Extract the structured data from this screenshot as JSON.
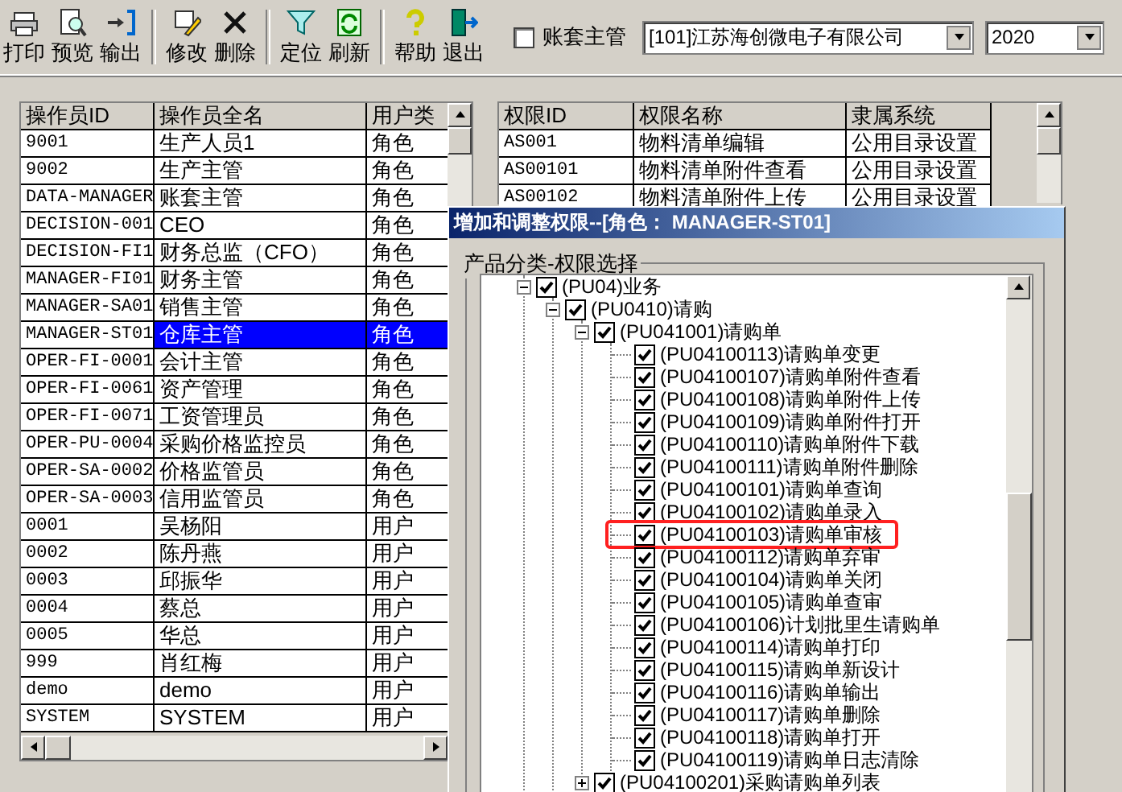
{
  "toolbar": {
    "groups": [
      [
        {
          "label": "打印"
        },
        {
          "label": "预览"
        },
        {
          "label": "输出"
        }
      ],
      [
        {
          "label": "修改"
        },
        {
          "label": "删除"
        }
      ],
      [
        {
          "label": "定位"
        },
        {
          "label": "刷新"
        }
      ],
      [
        {
          "label": "帮助"
        },
        {
          "label": "退出"
        }
      ]
    ],
    "checkbox": {
      "label": "账套主管",
      "checked": false
    },
    "company": {
      "value": "[101]江苏海创微电子有限公司"
    },
    "year": {
      "value": "2020"
    }
  },
  "operators": {
    "columns": [
      "操作员ID",
      "操作员全名",
      "用户类"
    ],
    "rows": [
      {
        "cells": [
          "9001",
          "生产人员1",
          "角色"
        ],
        "selected": false
      },
      {
        "cells": [
          "9002",
          "生产主管",
          "角色"
        ],
        "selected": false
      },
      {
        "cells": [
          "DATA-MANAGER",
          "账套主管",
          "角色"
        ],
        "selected": false
      },
      {
        "cells": [
          "DECISION-001",
          "CEO",
          "角色"
        ],
        "selected": false
      },
      {
        "cells": [
          "DECISION-FI1",
          "财务总监（CFO）",
          "角色"
        ],
        "selected": false
      },
      {
        "cells": [
          "MANAGER-FI01",
          "财务主管",
          "角色"
        ],
        "selected": false
      },
      {
        "cells": [
          "MANAGER-SA01",
          "销售主管",
          "角色"
        ],
        "selected": false
      },
      {
        "cells": [
          "MANAGER-ST01",
          "仓库主管",
          "角色"
        ],
        "selected": true
      },
      {
        "cells": [
          "OPER-FI-0001",
          "会计主管",
          "角色"
        ],
        "selected": false
      },
      {
        "cells": [
          "OPER-FI-0061",
          "资产管理",
          "角色"
        ],
        "selected": false
      },
      {
        "cells": [
          "OPER-FI-0071",
          "工资管理员",
          "角色"
        ],
        "selected": false
      },
      {
        "cells": [
          "OPER-PU-0004",
          "采购价格监控员",
          "角色"
        ],
        "selected": false
      },
      {
        "cells": [
          "OPER-SA-0002",
          "价格监管员",
          "角色"
        ],
        "selected": false
      },
      {
        "cells": [
          "OPER-SA-0003",
          "信用监管员",
          "角色"
        ],
        "selected": false
      },
      {
        "cells": [
          "0001",
          "吴杨阳",
          "用户"
        ],
        "selected": false
      },
      {
        "cells": [
          "0002",
          "陈丹燕",
          "用户"
        ],
        "selected": false
      },
      {
        "cells": [
          "0003",
          "邱振华",
          "用户"
        ],
        "selected": false
      },
      {
        "cells": [
          "0004",
          "蔡总",
          "用户"
        ],
        "selected": false
      },
      {
        "cells": [
          "0005",
          "华总",
          "用户"
        ],
        "selected": false
      },
      {
        "cells": [
          "999",
          "肖红梅",
          "用户"
        ],
        "selected": false
      },
      {
        "cells": [
          "demo",
          "demo",
          "用户"
        ],
        "selected": false
      },
      {
        "cells": [
          "SYSTEM",
          "SYSTEM",
          "用户"
        ],
        "selected": false
      }
    ]
  },
  "permissions": {
    "columns": [
      "权限ID",
      "权限名称",
      "隶属系统"
    ],
    "rows": [
      {
        "cells": [
          "AS001",
          "物料清单编辑",
          "公用目录设置"
        ]
      },
      {
        "cells": [
          "AS00101",
          "物料清单附件查看",
          "公用目录设置"
        ]
      },
      {
        "cells": [
          "AS00102",
          "物料清单附件上传",
          "公用目录设置"
        ]
      }
    ]
  },
  "dialog": {
    "title": "增加和调整权限--[角色： MANAGER-ST01]",
    "group_label": "产品分类-权限选择",
    "tree": [
      {
        "label": "(PU04)业务",
        "checked": true,
        "expanded": true,
        "children": [
          {
            "label": "(PU0410)请购",
            "checked": true,
            "expanded": true,
            "children": [
              {
                "label": "(PU041001)请购单",
                "checked": true,
                "expanded": true,
                "children": [
                  {
                    "label": "(PU04100113)请购单变更",
                    "checked": true,
                    "highlighted": false
                  },
                  {
                    "label": "(PU04100107)请购单附件查看",
                    "checked": true,
                    "highlighted": false
                  },
                  {
                    "label": "(PU04100108)请购单附件上传",
                    "checked": true,
                    "highlighted": false
                  },
                  {
                    "label": "(PU04100109)请购单附件打开",
                    "checked": true,
                    "highlighted": false
                  },
                  {
                    "label": "(PU04100110)请购单附件下载",
                    "checked": true,
                    "highlighted": false
                  },
                  {
                    "label": "(PU04100111)请购单附件删除",
                    "checked": true,
                    "highlighted": false
                  },
                  {
                    "label": "(PU04100101)请购单查询",
                    "checked": true,
                    "highlighted": false
                  },
                  {
                    "label": "(PU04100102)请购单录入",
                    "checked": true,
                    "highlighted": false
                  },
                  {
                    "label": "(PU04100103)请购单审核",
                    "checked": true,
                    "highlighted": true
                  },
                  {
                    "label": "(PU04100112)请购单弃审",
                    "checked": true,
                    "highlighted": false
                  },
                  {
                    "label": "(PU04100104)请购单关闭",
                    "checked": true,
                    "highlighted": false
                  },
                  {
                    "label": "(PU04100105)请购单查审",
                    "checked": true,
                    "highlighted": false
                  },
                  {
                    "label": "(PU04100106)计划批里生请购单",
                    "checked": true,
                    "highlighted": false
                  },
                  {
                    "label": "(PU04100114)请购单打印",
                    "checked": true,
                    "highlighted": false
                  },
                  {
                    "label": "(PU04100115)请购单新设计",
                    "checked": true,
                    "highlighted": false
                  },
                  {
                    "label": "(PU04100116)请购单输出",
                    "checked": true,
                    "highlighted": false
                  },
                  {
                    "label": "(PU04100117)请购单删除",
                    "checked": true,
                    "highlighted": false
                  },
                  {
                    "label": "(PU04100118)请购单打开",
                    "checked": true,
                    "highlighted": false
                  },
                  {
                    "label": "(PU04100119)请购单日志清除",
                    "checked": true,
                    "highlighted": false
                  }
                ]
              },
              {
                "label": "(PU04100201)采购请购单列表",
                "checked": true,
                "expanded": false
              }
            ]
          }
        ]
      }
    ]
  }
}
